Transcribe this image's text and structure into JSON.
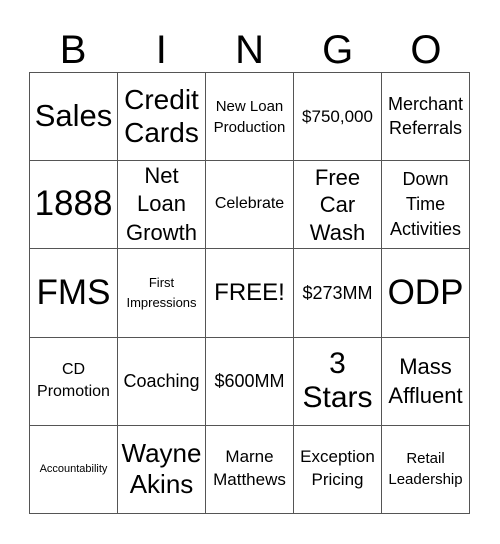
{
  "header": [
    "B",
    "I",
    "N",
    "G",
    "O"
  ],
  "cells": [
    [
      "Sales",
      "Credit Cards",
      "New Loan Production",
      "$750,000",
      "Merchant Referrals"
    ],
    [
      "1888",
      "Net Loan Growth",
      "Celebrate",
      "Free Car Wash",
      "Down Time Activities"
    ],
    [
      "FMS",
      "First Impressions",
      "FREE!",
      "$273MM",
      "ODP"
    ],
    [
      "CD Promotion",
      "Coaching",
      "$600MM",
      "3 Stars",
      "Mass Affluent"
    ],
    [
      "Accountability",
      "Wayne Akins",
      "Marne Matthews",
      "Exception Pricing",
      "Retail Leadership"
    ]
  ]
}
